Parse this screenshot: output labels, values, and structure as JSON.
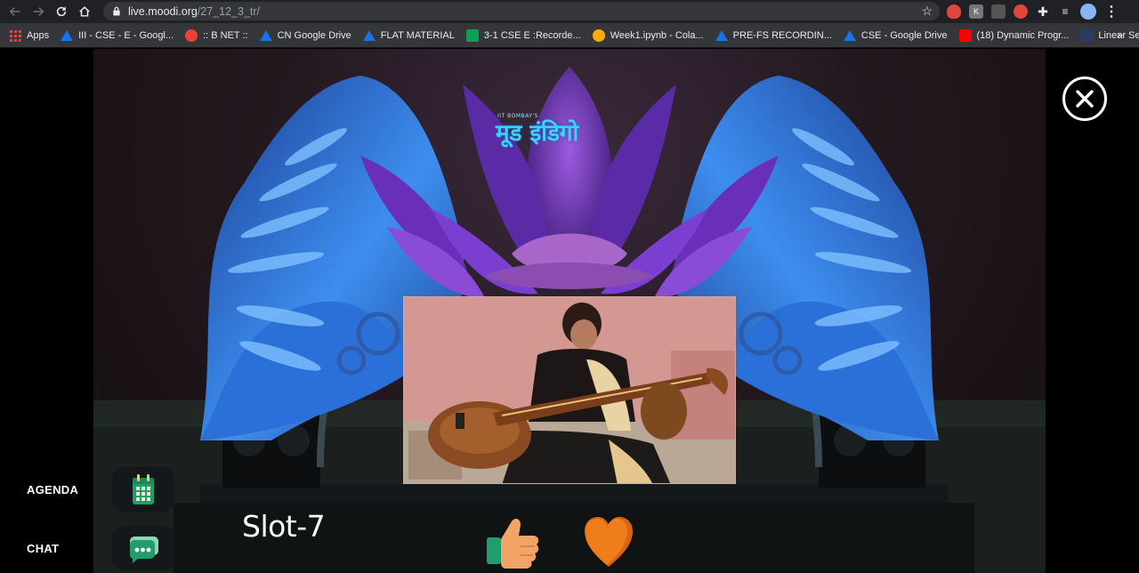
{
  "browser": {
    "url_host": "live.moodi.org",
    "url_path": "/27_12_3_tr/",
    "bookmarks": [
      {
        "label": "Apps",
        "icon": "apps-grid-icon",
        "color": "#e8eaed"
      },
      {
        "label": "III - CSE - E - Googl...",
        "icon": "google-drive-icon",
        "color": "#1a73e8"
      },
      {
        "label": ":: B NET ::",
        "icon": "google-icon",
        "color": "#ea4335"
      },
      {
        "label": "CN Google Drive",
        "icon": "google-drive-icon",
        "color": "#1a73e8"
      },
      {
        "label": "FLAT MATERIAL",
        "icon": "google-drive-icon",
        "color": "#1a73e8"
      },
      {
        "label": "3-1 CSE E :Recorde...",
        "icon": "google-sheets-icon",
        "color": "#0f9d58"
      },
      {
        "label": "Week1.ipynb - Cola...",
        "icon": "colab-icon",
        "color": "#f9ab00"
      },
      {
        "label": "PRE-FS RECORDIN...",
        "icon": "google-drive-icon",
        "color": "#1a73e8"
      },
      {
        "label": "CSE - Google Drive",
        "icon": "google-drive-icon",
        "color": "#1a73e8"
      },
      {
        "label": "(18) Dynamic Progr...",
        "icon": "youtube-icon",
        "color": "#ff0000"
      },
      {
        "label": "Linear Search Tutori...",
        "icon": "site-favicon-icon",
        "color": "#2b3a67"
      }
    ],
    "bookmarks_more": "»"
  },
  "event": {
    "logo_small": "IIT BOMBAY'S",
    "logo_main": "मूड इंडिगो"
  },
  "sidebar": {
    "agenda_label": "AGENDA",
    "chat_label": "CHAT"
  },
  "stage": {
    "slot_title": "Slot-7"
  },
  "colors": {
    "accent_green": "#1f9d6b",
    "butterfly_blue": "#3d8ef0",
    "lotus_purple": "#6a2fb8",
    "like_orange": "#f2a466",
    "heart_orange": "#ef7d1c"
  }
}
